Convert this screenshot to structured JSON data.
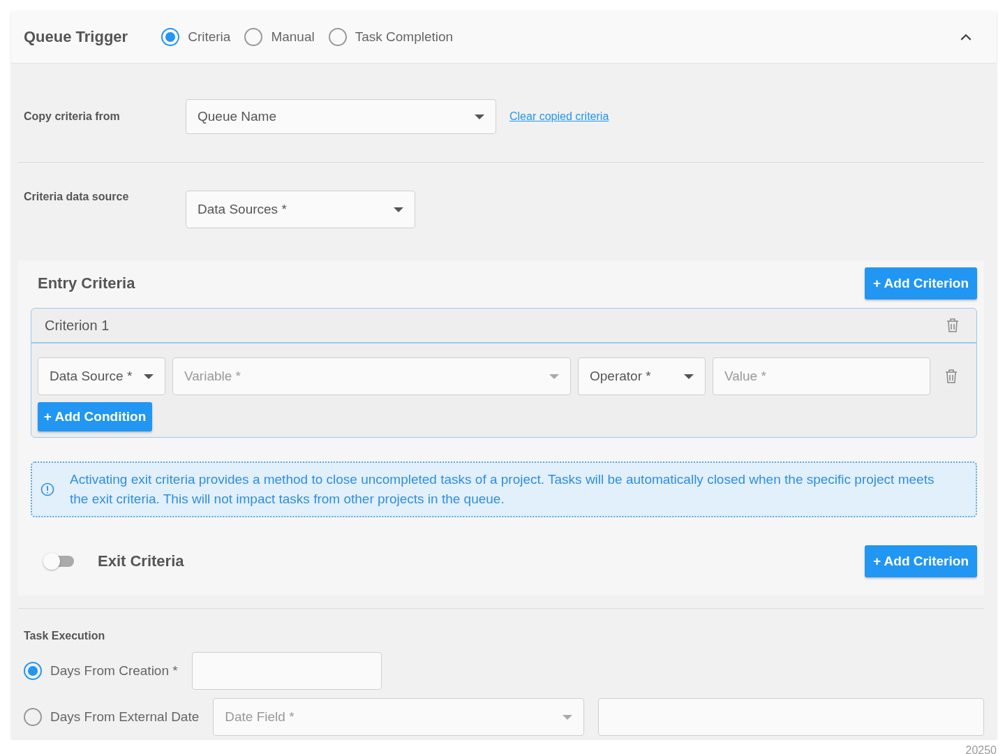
{
  "header": {
    "title": "Queue Trigger",
    "expanded": true,
    "trigger_options": [
      {
        "label": "Criteria",
        "selected": true
      },
      {
        "label": "Manual",
        "selected": false
      },
      {
        "label": "Task Completion",
        "selected": false
      }
    ]
  },
  "copy_criteria": {
    "label": "Copy criteria from",
    "dropdown": {
      "label": "Queue Name",
      "disabled": false
    },
    "link": "Clear copied criteria"
  },
  "data_source": {
    "label": "Criteria data source",
    "dropdown": {
      "label": "Data Sources *",
      "disabled": false
    }
  },
  "entry_criteria": {
    "title": "Entry Criteria",
    "add_button": "+ Add Criterion",
    "criteria": [
      {
        "title": "Criterion 1",
        "add_condition": "+ Add Condition",
        "conditions": [
          {
            "fields": [
              {
                "kind": "dropdown",
                "label": "Data Source *",
                "disabled": false
              },
              {
                "kind": "dropdown",
                "label": "Variable *",
                "disabled": true
              },
              {
                "kind": "dropdown",
                "label": "Operator *",
                "disabled": false
              },
              {
                "kind": "input",
                "placeholder": "Value *"
              }
            ]
          }
        ]
      }
    ]
  },
  "info_message": "Activating exit criteria provides a method to close uncompleted tasks of a project. Tasks will be automatically closed when the specific project meets the exit criteria. This will not impact tasks from other projects in the queue.",
  "exit_criteria": {
    "title": "Exit Criteria",
    "on": false,
    "add_button": "+ Add Criterion"
  },
  "task_execution": {
    "label": "Task Execution",
    "options": [
      {
        "label": "Days From Creation *",
        "selected": true,
        "fields": [
          {
            "kind": "input"
          }
        ]
      },
      {
        "label": "Days From External Date",
        "selected": false,
        "fields": [
          {
            "kind": "dropdown",
            "label": "Date Field *",
            "disabled": true
          },
          {
            "kind": "input"
          }
        ]
      }
    ]
  },
  "footer_text": "20250"
}
